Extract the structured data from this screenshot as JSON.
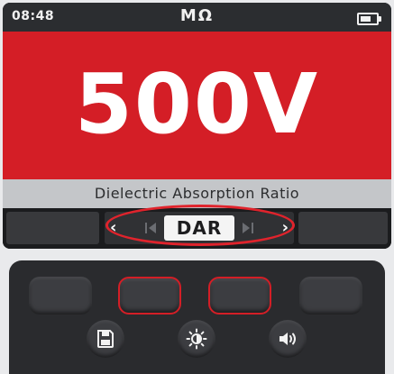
{
  "status_bar": {
    "time": "08:48",
    "unit": "MΩ",
    "battery_level": 0.7
  },
  "display": {
    "test_voltage": "500V",
    "function_title": "Dielectric Absorption Ratio"
  },
  "selector": {
    "current_option": "DAR",
    "icons": [
      "chevron-left-icon",
      "skip-back-icon",
      "skip-forward-icon",
      "chevron-right-icon"
    ]
  },
  "keypad": {
    "round_keys": [
      "save-icon",
      "brightness-icon",
      "speaker-icon"
    ]
  },
  "colors": {
    "accent_red": "#d41e26",
    "screen_dark": "#1e2022",
    "title_bar": "#c4c6c9"
  }
}
